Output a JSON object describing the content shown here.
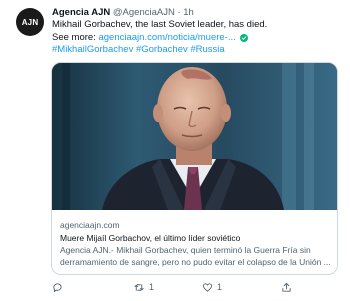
{
  "tweet": {
    "avatar_text": "AJN",
    "author_name": "Agencia AJN",
    "author_handle": "@AgenciaAJN",
    "separator": "·",
    "time": "1h",
    "text_line1": "Mikhail Gorbachev, the last Soviet leader, has died.",
    "see_more_label": "See more:",
    "link_text": "agenciaajn.com/noticia/muere-...",
    "hashtags": [
      "#MikhailGorbachev",
      "#Gorbachev",
      "#Russia"
    ]
  },
  "card": {
    "domain": "agenciaajn.com",
    "title": "Muere Mijaíl Gorbachov, el último líder soviético",
    "description_line1": "Agencia AJN.- Mikhail Gorbachev, quien terminó la Guerra Fría sin",
    "description_line2": "derramamiento de sangre, pero no pudo evitar el colapso de la Unión ..."
  },
  "actions": {
    "reply_count": "",
    "retweet_count": "1",
    "like_count": "1",
    "share_count": ""
  },
  "colors": {
    "accent": "#1d9bf0",
    "verified": "#00ba7c",
    "muted": "#536471",
    "border": "#cfd9de"
  },
  "icons": [
    "reply-icon",
    "retweet-icon",
    "like-icon",
    "share-icon",
    "verified-icon"
  ]
}
